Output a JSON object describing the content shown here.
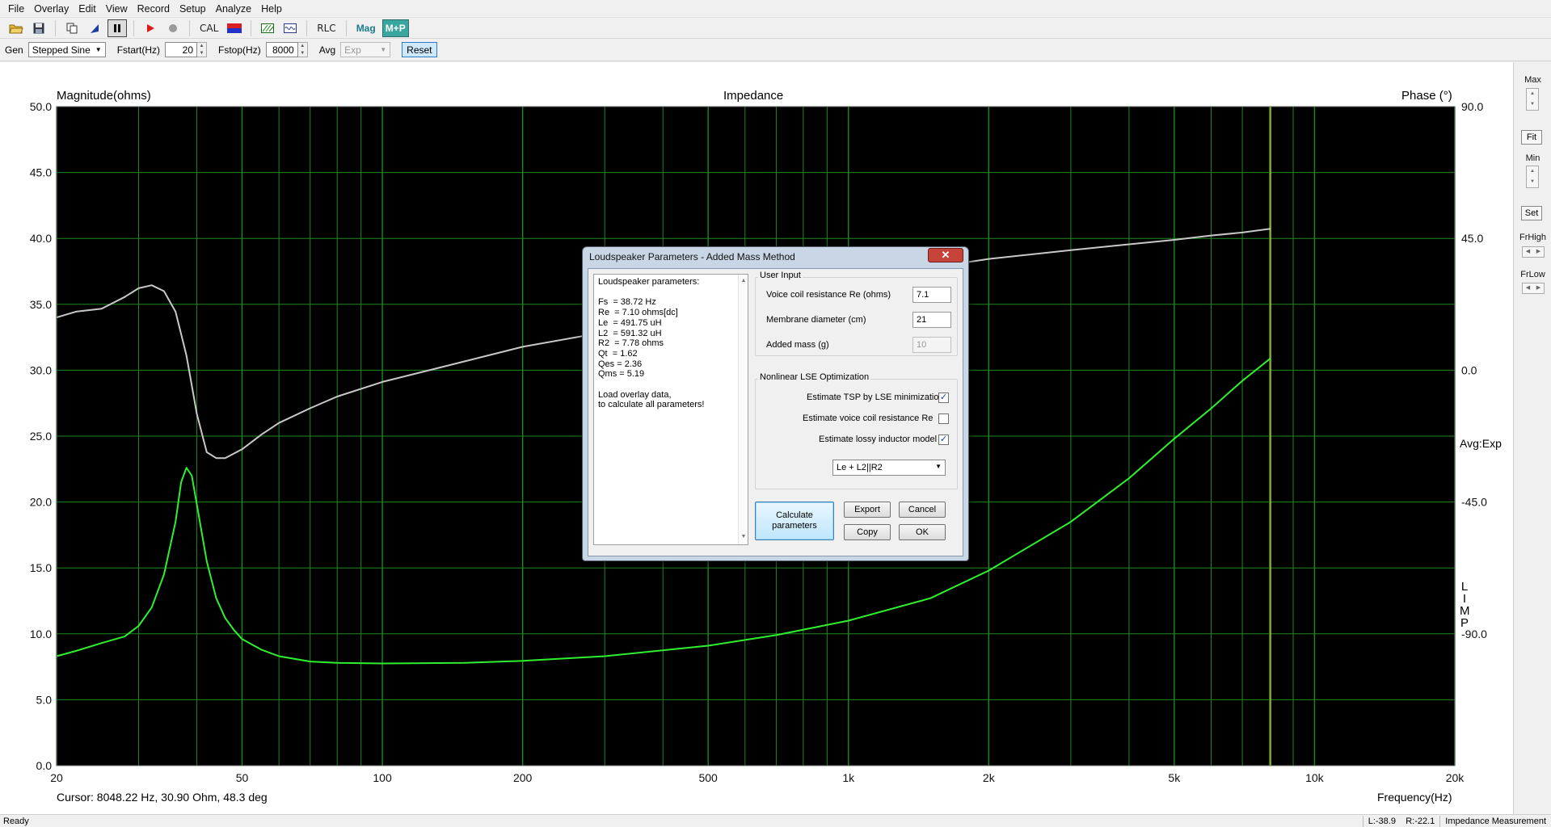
{
  "menu": [
    "File",
    "Overlay",
    "Edit",
    "View",
    "Record",
    "Setup",
    "Analyze",
    "Help"
  ],
  "toolbar": {
    "open_icon": "folder-open-icon",
    "save_icon": "floppy-icon",
    "copy_icon": "copy-icon",
    "marker_icon": "flag-marker-icon",
    "pause_icon": "pause-icon",
    "play_icon": "play-icon",
    "stop_icon": "stop-icon",
    "cal_label": "CAL",
    "rlc_label": "RLC",
    "mag_label": "Mag",
    "mp_label": "M+P"
  },
  "genbar": {
    "gen_label": "Gen",
    "gen_value": "Stepped Sine",
    "fstart_label": "Fstart(Hz)",
    "fstart_value": "20",
    "fstop_label": "Fstop(Hz)",
    "fstop_value": "8000",
    "avg_label": "Avg",
    "avg_value": "Exp",
    "reset_label": "Reset"
  },
  "plot": {
    "left_axis_title": "Magnitude(ohms)",
    "center_title": "Impedance",
    "right_axis_title": "Phase (°)",
    "avg_label": "Avg:Exp",
    "limp_label": [
      "L",
      "I",
      "M",
      "P"
    ],
    "cursor_text": "Cursor: 8048.22 Hz, 30.90 Ohm, 48.3 deg",
    "xaxis_label": "Frequency(Hz)",
    "left_ticks": [
      "50.0",
      "45.0",
      "40.0",
      "35.0",
      "30.0",
      "25.0",
      "20.0",
      "15.0",
      "10.0",
      "5.0",
      "0.0"
    ],
    "right_ticks": [
      "90.0",
      "45.0",
      "0.0",
      "-45.0",
      "-90.0"
    ],
    "x_ticks": [
      {
        "f": 20,
        "label": "20"
      },
      {
        "f": 50,
        "label": "50"
      },
      {
        "f": 100,
        "label": "100"
      },
      {
        "f": 200,
        "label": "200"
      },
      {
        "f": 500,
        "label": "500"
      },
      {
        "f": 1000,
        "label": "1k"
      },
      {
        "f": 2000,
        "label": "2k"
      },
      {
        "f": 5000,
        "label": "5k"
      },
      {
        "f": 10000,
        "label": "10k"
      },
      {
        "f": 20000,
        "label": "20k"
      }
    ],
    "colors": {
      "background": "#000000",
      "grid": "#1e8a1e",
      "magnitude": "#2ef02e",
      "phase": "#c8c8c8",
      "cursor": "#c8c832"
    }
  },
  "chart_data": {
    "type": "line",
    "title": "Impedance",
    "xlabel": "Frequency(Hz)",
    "ylabel": "Magnitude(ohms)",
    "y2label": "Phase (°)",
    "xscale": "log",
    "xlim": [
      20,
      20000
    ],
    "ylim": [
      0,
      50
    ],
    "y2lim": [
      -135,
      90
    ],
    "grid": true,
    "cursor_x": 8048.22,
    "series": [
      {
        "name": "Magnitude",
        "axis": "left",
        "x": [
          20,
          22,
          25,
          28,
          30,
          32,
          34,
          36,
          37,
          38,
          39,
          40,
          42,
          44,
          46,
          48,
          50,
          55,
          60,
          70,
          80,
          100,
          150,
          200,
          300,
          500,
          700,
          1000,
          1500,
          2000,
          3000,
          4000,
          5000,
          6000,
          7000,
          8048
        ],
        "values": [
          8.3,
          8.7,
          9.3,
          9.8,
          10.6,
          12.0,
          14.5,
          18.5,
          21.5,
          22.6,
          22.0,
          19.8,
          15.5,
          12.7,
          11.2,
          10.3,
          9.6,
          8.8,
          8.3,
          7.9,
          7.8,
          7.75,
          7.8,
          7.95,
          8.3,
          9.1,
          9.9,
          11.0,
          12.7,
          14.8,
          18.5,
          21.8,
          24.8,
          27.1,
          29.2,
          30.9
        ]
      },
      {
        "name": "Phase",
        "axis": "right",
        "x": [
          20,
          22,
          25,
          28,
          30,
          32,
          34,
          36,
          38,
          40,
          42,
          44,
          46,
          50,
          55,
          60,
          70,
          80,
          100,
          150,
          200,
          300,
          500,
          700,
          1000,
          1500,
          2000,
          3000,
          4000,
          5000,
          6000,
          7000,
          8048
        ],
        "values": [
          18,
          20,
          21,
          25,
          28,
          29,
          27,
          20,
          5,
          -15,
          -28,
          -30,
          -30,
          -27,
          -22,
          -18,
          -13,
          -9,
          -4,
          3,
          8,
          13,
          20,
          25,
          30,
          35,
          38,
          41,
          43,
          44.5,
          46,
          47,
          48.3
        ]
      }
    ]
  },
  "rpanel": {
    "max": "Max",
    "fit": "Fit",
    "min": "Min",
    "set": "Set",
    "frhigh": "FrHigh",
    "frlow": "FrLow"
  },
  "status": {
    "ready": "Ready",
    "lr": "L:-38.9    R:-22.1",
    "mode": "Impedance Measurement"
  },
  "dialog": {
    "title": "Loudspeaker Parameters - Added Mass Method",
    "results_lines": [
      "Loudspeaker parameters:",
      "",
      "Fs  = 38.72 Hz",
      "Re  = 7.10 ohms[dc]",
      "Le  = 491.75 uH",
      "L2  = 591.32 uH",
      "R2  = 7.78 ohms",
      "Qt  = 1.62",
      "Qes = 2.36",
      "Qms = 5.19",
      "",
      "Load overlay data,",
      "to calculate all parameters!"
    ],
    "user_input_title": "User Input",
    "re_label": "Voice coil resistance Re (ohms)",
    "re_value": "7.1",
    "diam_label": "Membrane diameter (cm)",
    "diam_value": "21",
    "mass_label": "Added mass (g)",
    "mass_value": "10",
    "nl_title": "Nonlinear LSE Optimization",
    "chk1_label": "Estimate TSP by LSE minimization",
    "chk1": true,
    "chk2_label": "Estimate voice coil resistance Re",
    "chk2": false,
    "chk3_label": "Estimate lossy inductor model",
    "chk3": true,
    "model_value": "Le + L2||R2",
    "calc_line1": "Calculate",
    "calc_line2": "parameters",
    "export": "Export",
    "cancel": "Cancel",
    "copy": "Copy",
    "ok": "OK"
  }
}
